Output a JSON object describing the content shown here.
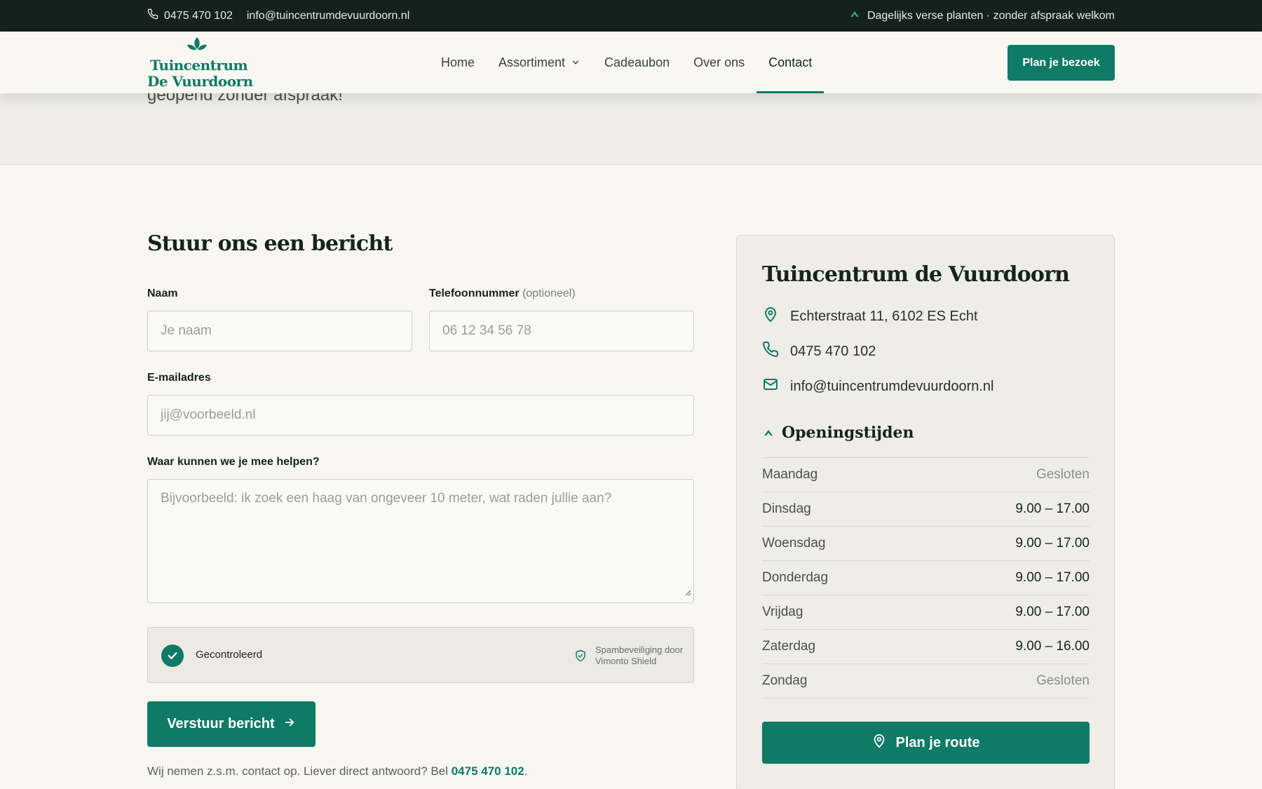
{
  "topbar": {
    "phone": "0475 470 102",
    "email": "info@tuincentrumdevuurdoorn.nl",
    "tagline": "Dagelijks verse planten · zonder afspraak welkom"
  },
  "hero": {
    "text_fragment": "geopend zonder afspraak!"
  },
  "header": {
    "logo_line1": "Tuincentrum",
    "logo_line2": "De Vuurdoorn",
    "nav": [
      {
        "label": "Home"
      },
      {
        "label": "Assortiment"
      },
      {
        "label": "Cadeaubon"
      },
      {
        "label": "Over ons"
      },
      {
        "label": "Contact"
      }
    ],
    "cta": "Plan je bezoek"
  },
  "form": {
    "title": "Stuur ons een bericht",
    "name_label": "Naam",
    "name_placeholder": "Je naam",
    "phone_label": "Telefoonnummer",
    "phone_optional": "(optioneel)",
    "phone_placeholder": "06 12 34 56 78",
    "email_label": "E-mailadres",
    "email_placeholder": "jij@voorbeeld.nl",
    "message_label": "Waar kunnen we je mee helpen?",
    "message_placeholder": "Bijvoorbeeld: ik zoek een haag van ongeveer 10 meter, wat raden jullie aan?",
    "captcha_status": "Gecontroleerd",
    "captcha_by_line1": "Spambeveiliging door",
    "captcha_by_line2": "Vimonto Shield",
    "submit": "Verstuur bericht",
    "note_text": "Wij nemen z.s.m. contact op. Liever direct antwoord? Bel ",
    "note_phone": "0475 470 102",
    "note_end": "."
  },
  "card": {
    "title": "Tuincentrum de Vuurdoorn",
    "address": "Echterstraat 11, 6102 ES Echt",
    "phone": "0475 470 102",
    "email": "info@tuincentrumdevuurdoorn.nl",
    "hours_title": "Openingstijden",
    "hours": [
      {
        "day": "Maandag",
        "time": "Gesloten"
      },
      {
        "day": "Dinsdag",
        "time": "9.00 – 17.00"
      },
      {
        "day": "Woensdag",
        "time": "9.00 – 17.00"
      },
      {
        "day": "Donderdag",
        "time": "9.00 – 17.00"
      },
      {
        "day": "Vrijdag",
        "time": "9.00 – 17.00"
      },
      {
        "day": "Zaterdag",
        "time": "9.00 – 16.00"
      },
      {
        "day": "Zondag",
        "time": "Gesloten"
      }
    ],
    "route_button": "Plan je route"
  },
  "colors": {
    "brand": "#0f7a66",
    "topbar": "#15211d",
    "background": "#f7f6f1"
  }
}
